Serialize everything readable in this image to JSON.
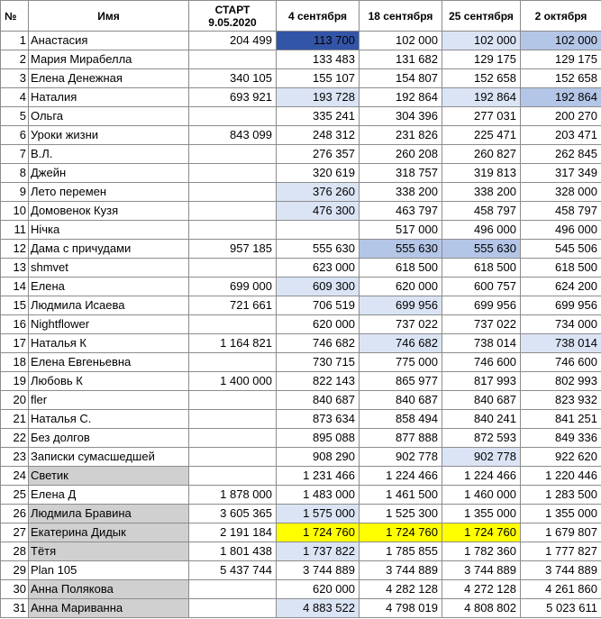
{
  "columns": [
    "№",
    "Имя",
    "СТАРТ 9.05.2020",
    "4 сентября",
    "18 сентября",
    "25 сентября",
    "2 октября"
  ],
  "rows": [
    {
      "num": "1",
      "name": "Анастасия",
      "start": "204 499",
      "v": [
        "113 700",
        "102 000",
        "102 000",
        "102 000"
      ],
      "hl": [
        "dark",
        "",
        "light",
        "mid"
      ]
    },
    {
      "num": "2",
      "name": "Мария Мирабелла",
      "start": "",
      "v": [
        "133 483",
        "131 682",
        "129 175",
        "129 175"
      ],
      "hl": [
        "",
        "",
        "",
        ""
      ]
    },
    {
      "num": "3",
      "name": "Елена Денежная",
      "start": "340 105",
      "v": [
        "155 107",
        "154 807",
        "152 658",
        "152 658"
      ],
      "hl": [
        "",
        "",
        "",
        ""
      ]
    },
    {
      "num": "4",
      "name": "Наталия",
      "start": "693 921",
      "v": [
        "193 728",
        "192 864",
        "192 864",
        "192 864"
      ],
      "hl": [
        "light",
        "",
        "light",
        "mid"
      ]
    },
    {
      "num": "5",
      "name": "Ольга",
      "start": "",
      "v": [
        "335 241",
        "304 396",
        "277 031",
        "200 270"
      ],
      "hl": [
        "",
        "",
        "",
        ""
      ]
    },
    {
      "num": "6",
      "name": "Уроки жизни",
      "start": "843 099",
      "v": [
        "248 312",
        "231 826",
        "225 471",
        "203 471"
      ],
      "hl": [
        "",
        "",
        "",
        ""
      ]
    },
    {
      "num": "7",
      "name": "В.Л.",
      "start": "",
      "v": [
        "276 357",
        "260 208",
        "260 827",
        "262 845"
      ],
      "hl": [
        "",
        "",
        "",
        ""
      ]
    },
    {
      "num": "8",
      "name": "Джейн",
      "start": "",
      "v": [
        "320 619",
        "318 757",
        "319 813",
        "317 349"
      ],
      "hl": [
        "",
        "",
        "",
        ""
      ]
    },
    {
      "num": "9",
      "name": "Лето перемен",
      "start": "",
      "v": [
        "376 260",
        "338 200",
        "338 200",
        "328 000"
      ],
      "hl": [
        "light",
        "",
        "",
        ""
      ]
    },
    {
      "num": "10",
      "name": "Домовенок Кузя",
      "start": "",
      "v": [
        "476 300",
        "463 797",
        "458 797",
        "458 797"
      ],
      "hl": [
        "light",
        "",
        "",
        ""
      ]
    },
    {
      "num": "11",
      "name": "Нічка",
      "start": "",
      "v": [
        "",
        "517 000",
        "496 000",
        "496 000"
      ],
      "hl": [
        "",
        "",
        "",
        ""
      ]
    },
    {
      "num": "12",
      "name": "Дама с причудами",
      "start": "957 185",
      "v": [
        "555 630",
        "555 630",
        "555 630",
        "545 506"
      ],
      "hl": [
        "",
        "mid",
        "mid",
        ""
      ]
    },
    {
      "num": "13",
      "name": "shmvet",
      "start": "",
      "v": [
        "623 000",
        "618 500",
        "618 500",
        "618 500"
      ],
      "hl": [
        "",
        "",
        "",
        ""
      ]
    },
    {
      "num": "14",
      "name": "Елена",
      "start": "699 000",
      "v": [
        "609 300",
        "620 000",
        "600 757",
        "624 200"
      ],
      "hl": [
        "light",
        "",
        "",
        ""
      ]
    },
    {
      "num": "15",
      "name": "Людмила Исаева",
      "start": "721 661",
      "v": [
        "706 519",
        "699 956",
        "699 956",
        "699 956"
      ],
      "hl": [
        "",
        "light",
        "",
        ""
      ]
    },
    {
      "num": "16",
      "name": "Nightflower",
      "start": "",
      "v": [
        "620 000",
        "737 022",
        "737 022",
        "734 000"
      ],
      "hl": [
        "",
        "",
        "",
        ""
      ]
    },
    {
      "num": "17",
      "name": "Наталья К",
      "start": "1 164 821",
      "v": [
        "746 682",
        "746 682",
        "738 014",
        "738 014"
      ],
      "hl": [
        "",
        "light",
        "",
        "light"
      ]
    },
    {
      "num": "18",
      "name": "Елена Евгеньевна",
      "start": "",
      "v": [
        "730 715",
        "775 000",
        "746 600",
        "746 600"
      ],
      "hl": [
        "",
        "",
        "",
        ""
      ]
    },
    {
      "num": "19",
      "name": "Любовь К",
      "start": "1 400 000",
      "v": [
        "822 143",
        "865 977",
        "817 993",
        "802 993"
      ],
      "hl": [
        "",
        "",
        "",
        ""
      ]
    },
    {
      "num": "20",
      "name": "fler",
      "start": "",
      "v": [
        "840 687",
        "840 687",
        "840 687",
        "823 932"
      ],
      "hl": [
        "",
        "",
        "",
        ""
      ]
    },
    {
      "num": "21",
      "name": "Наталья С.",
      "start": "",
      "v": [
        "873 634",
        "858 494",
        "840 241",
        "841 251"
      ],
      "hl": [
        "",
        "",
        "",
        ""
      ]
    },
    {
      "num": "22",
      "name": "Без долгов",
      "start": "",
      "v": [
        "895 088",
        "877 888",
        "872 593",
        "849 336"
      ],
      "hl": [
        "",
        "",
        "",
        ""
      ]
    },
    {
      "num": "23",
      "name": "Записки сумасшедшей",
      "start": "",
      "v": [
        "908 290",
        "902 778",
        "902 778",
        "922 620"
      ],
      "hl": [
        "",
        "",
        "light",
        ""
      ]
    },
    {
      "num": "24",
      "name": "Светик",
      "start": "",
      "v": [
        "1 231 466",
        "1 224 466",
        "1 224 466",
        "1 220 446"
      ],
      "hl": [
        "",
        "",
        "",
        ""
      ],
      "grey": true
    },
    {
      "num": "25",
      "name": "Елена Д",
      "start": "1 878 000",
      "v": [
        "1 483 000",
        "1 461 500",
        "1 460 000",
        "1 283 500"
      ],
      "hl": [
        "",
        "",
        "",
        ""
      ]
    },
    {
      "num": "26",
      "name": "Людмила Бравина",
      "start": "3 605 365",
      "v": [
        "1 575 000",
        "1 525 300",
        "1 355 000",
        "1 355 000"
      ],
      "hl": [
        "light",
        "",
        "",
        ""
      ],
      "grey": true
    },
    {
      "num": "27",
      "name": "Екатерина Дидык",
      "start": "2 191 184",
      "v": [
        "1 724 760",
        "1 724 760",
        "1 724 760",
        "1 679 807"
      ],
      "hl": [
        "yellow",
        "yellow",
        "yellow",
        ""
      ],
      "grey": true
    },
    {
      "num": "28",
      "name": "Тётя",
      "start": "1 801 438",
      "v": [
        "1 737 822",
        "1 785 855",
        "1 782 360",
        "1 777 827"
      ],
      "hl": [
        "light",
        "",
        "",
        ""
      ],
      "grey": true
    },
    {
      "num": "29",
      "name": "Plan 105",
      "start": "5 437 744",
      "v": [
        "3 744 889",
        "3 744 889",
        "3 744 889",
        "3 744 889"
      ],
      "hl": [
        "",
        "",
        "",
        ""
      ]
    },
    {
      "num": "30",
      "name": "Анна Полякова",
      "start": "",
      "v": [
        "620 000",
        "4 282 128",
        "4 272 128",
        "4 261 860"
      ],
      "hl": [
        "",
        "",
        "",
        ""
      ],
      "grey": true
    },
    {
      "num": "31",
      "name": "Анна Мариванна",
      "start": "",
      "v": [
        "4 883 522",
        "4 798 019",
        "4 808 802",
        "5 023 611"
      ],
      "hl": [
        "light",
        "",
        "",
        ""
      ],
      "grey": true
    }
  ],
  "colors": {
    "dark_blue": "#3355a8",
    "mid_blue": "#b4c6e7",
    "light_blue": "#dbe4f4",
    "yellow": "#ffff00",
    "grey": "#d0d0d0"
  }
}
